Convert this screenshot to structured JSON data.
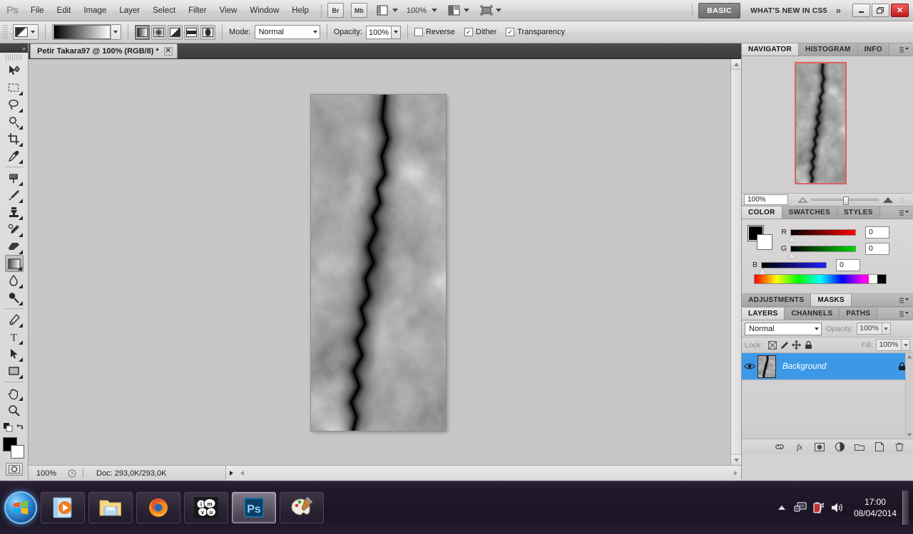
{
  "app": {
    "name": "Adobe Photoshop CS5",
    "logo": "Ps"
  },
  "menubar": {
    "items": [
      "File",
      "Edit",
      "Image",
      "Layer",
      "Select",
      "Filter",
      "View",
      "Window",
      "Help"
    ],
    "bridge_label": "Br",
    "minibridge_label": "Mb",
    "zoom_label": "100%",
    "workspace_basic": "BASIC",
    "workspace_new": "WHAT'S NEW IN CS5",
    "more_chevron": "»",
    "window_minimize": "–",
    "window_restore": "❐",
    "window_close": "✕"
  },
  "options_bar": {
    "mode_label": "Mode:",
    "mode_value": "Normal",
    "opacity_label": "Opacity:",
    "opacity_value": "100%",
    "checkboxes": [
      {
        "label": "Reverse",
        "checked": false
      },
      {
        "label": "Dither",
        "checked": true
      },
      {
        "label": "Transparency",
        "checked": true
      }
    ],
    "gradient_types": [
      "linear-gradient",
      "radial-gradient",
      "angle-gradient",
      "reflected-gradient",
      "diamond-gradient"
    ],
    "active_gradient_type": "linear-gradient"
  },
  "toolbar": {
    "collapse_icon": "»",
    "tools": [
      {
        "name": "move-tool",
        "selected": false
      },
      {
        "name": "rectangular-marquee-tool",
        "selected": false
      },
      {
        "name": "lasso-tool",
        "selected": false
      },
      {
        "name": "quick-selection-tool",
        "selected": false
      },
      {
        "name": "crop-tool",
        "selected": false
      },
      {
        "name": "eyedropper-tool",
        "selected": false
      },
      {
        "name": "spot-healing-brush-tool",
        "selected": false
      },
      {
        "name": "brush-tool",
        "selected": false
      },
      {
        "name": "clone-stamp-tool",
        "selected": false
      },
      {
        "name": "history-brush-tool",
        "selected": false
      },
      {
        "name": "eraser-tool",
        "selected": false
      },
      {
        "name": "gradient-tool",
        "selected": true
      },
      {
        "name": "blur-tool",
        "selected": false
      },
      {
        "name": "dodge-tool",
        "selected": false
      },
      {
        "name": "pen-tool",
        "selected": false
      },
      {
        "name": "horizontal-type-tool",
        "selected": false
      },
      {
        "name": "path-selection-tool",
        "selected": false
      },
      {
        "name": "rectangle-tool",
        "selected": false
      },
      {
        "name": "hand-tool",
        "selected": false
      },
      {
        "name": "zoom-tool",
        "selected": false
      }
    ],
    "foreground_color": "#000000",
    "background_color": "#ffffff"
  },
  "document": {
    "tab_title": "Petir Takara97 @ 100% (RGB/8) *",
    "close_glyph": "✕"
  },
  "statusbar": {
    "zoom": "100%",
    "doc_info": "Doc: 293,0K/293,0K",
    "arrow_glyph": "▶"
  },
  "navigator_panel": {
    "tabs": [
      "NAVIGATOR",
      "HISTOGRAM",
      "INFO"
    ],
    "active_tab": "NAVIGATOR",
    "zoom_value": "100%",
    "view_box_color": "#e06060"
  },
  "color_panel": {
    "tabs": [
      "COLOR",
      "SWATCHES",
      "STYLES"
    ],
    "active_tab": "COLOR",
    "channels": [
      {
        "label": "R",
        "value": "0"
      },
      {
        "label": "G",
        "value": "0"
      },
      {
        "label": "B",
        "value": "0"
      }
    ]
  },
  "adjustments_panel": {
    "tabs": [
      "ADJUSTMENTS",
      "MASKS"
    ],
    "active_tab": "MASKS"
  },
  "layers_panel": {
    "tabs": [
      "LAYERS",
      "CHANNELS",
      "PATHS"
    ],
    "active_tab": "LAYERS",
    "blend_mode": "Normal",
    "opacity_label": "Opacity:",
    "opacity_value": "100%",
    "lock_label": "Lock:",
    "fill_label": "Fill:",
    "fill_value": "100%",
    "layers": [
      {
        "name": "Background",
        "visible": true,
        "locked": true,
        "selected": true
      }
    ],
    "footer_icons": [
      "link-icon",
      "fx-icon",
      "layer-mask-icon",
      "adjustment-layer-icon",
      "new-group-icon",
      "new-layer-icon",
      "delete-layer-icon"
    ]
  },
  "taskbar": {
    "start_label": "Start",
    "buttons": [
      {
        "name": "windows-media-player",
        "active": false
      },
      {
        "name": "windows-explorer",
        "active": false
      },
      {
        "name": "mozilla-firefox",
        "active": false
      },
      {
        "name": "imvu",
        "active": false
      },
      {
        "name": "adobe-photoshop",
        "active": true
      },
      {
        "name": "paint",
        "active": false
      }
    ],
    "tray_icons": [
      "show-hidden-icons-arrow",
      "network-icon",
      "battery-icon",
      "volume-icon"
    ],
    "time": "17:00",
    "date": "08/04/2014"
  }
}
